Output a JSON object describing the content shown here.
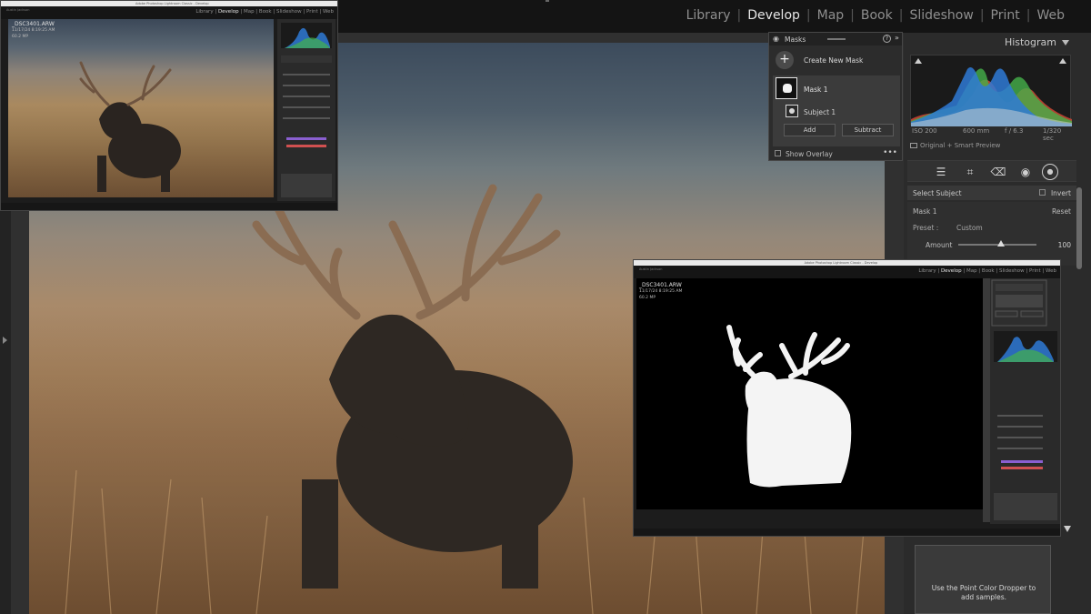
{
  "modules": {
    "library": "Library",
    "develop": "Develop",
    "map": "Map",
    "book": "Book",
    "slideshow": "Slideshow",
    "print": "Print",
    "web": "Web",
    "separator": "|"
  },
  "histogram": {
    "title": "Histogram",
    "iso": "ISO 200",
    "focal": "600 mm",
    "aperture": "f / 6.3",
    "shutter": "1/320 sec",
    "preview": "Original + Smart Preview"
  },
  "masks_panel": {
    "title": "Masks",
    "help": "?",
    "collapse": "»",
    "create_label": "Create New Mask",
    "plus": "+",
    "mask1_label": "Mask 1",
    "subject_label": "Subject 1",
    "add_label": "Add",
    "subtract_label": "Subtract",
    "show_overlay_label": "Show Overlay",
    "more": "•••"
  },
  "mask_tools": {
    "select_subject": "Select Subject",
    "invert": "Invert",
    "mask_name": "Mask 1",
    "reset": "Reset",
    "preset_label": "Preset :",
    "preset_value": "Custom",
    "amount_label": "Amount",
    "amount_value": "100",
    "amount_fraction": 0.55
  },
  "point_color": {
    "hint_line1": "Use the Point Color Dropper to",
    "hint_line2": "add samples."
  },
  "inset1": {
    "window_title": "Adobe Photoshop Lightroom Classic - Develop",
    "filename": "_DSC3401.ARW",
    "datetime": "11/17/24 8:19:25 AM",
    "megapixels": "60.2 MP",
    "user": "Austin Jackson",
    "nav": [
      "Library",
      "Develop",
      "Map",
      "Book",
      "Slideshow",
      "Print",
      "Web"
    ]
  },
  "inset2": {
    "window_title": "Adobe Photoshop Lightroom Classic - Develop",
    "filename": "_DSC3401.ARW",
    "datetime": "11/17/24 8:19:25 AM",
    "megapixels": "60.2 MP",
    "user": "Austin Jackson",
    "nav": [
      "Library",
      "Develop",
      "Map",
      "Book",
      "Slideshow",
      "Print",
      "Web"
    ]
  },
  "colors": {
    "accent": "#e6e6e6",
    "histogram_blue": "#2f7ad6",
    "histogram_green": "#45b04a",
    "histogram_red": "#d04535"
  }
}
